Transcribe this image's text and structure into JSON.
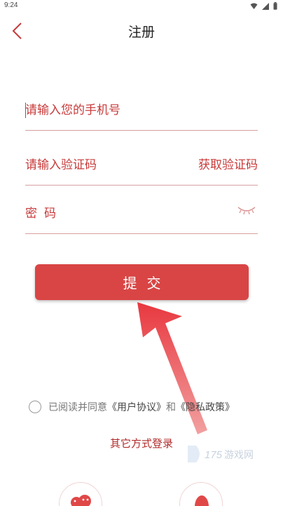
{
  "status_bar": {
    "time": "9:24"
  },
  "header": {
    "title": "注册"
  },
  "form": {
    "phone_placeholder": "请输入您的手机号",
    "code_placeholder": "请输入验证码",
    "get_code_label": "获取验证码",
    "password_placeholder": "密码"
  },
  "submit_label": "提交",
  "agreement": {
    "prefix": "已阅读并同意",
    "user_agreement": "《用户协议》",
    "and": "和",
    "privacy_policy": "《隐私政策》"
  },
  "other_login": "其它方式登录",
  "watermark": {
    "number": "175",
    "text": "游戏网"
  },
  "colors": {
    "accent": "#d94545",
    "text_red": "#c83a3a",
    "divider": "#d8a0a0"
  }
}
